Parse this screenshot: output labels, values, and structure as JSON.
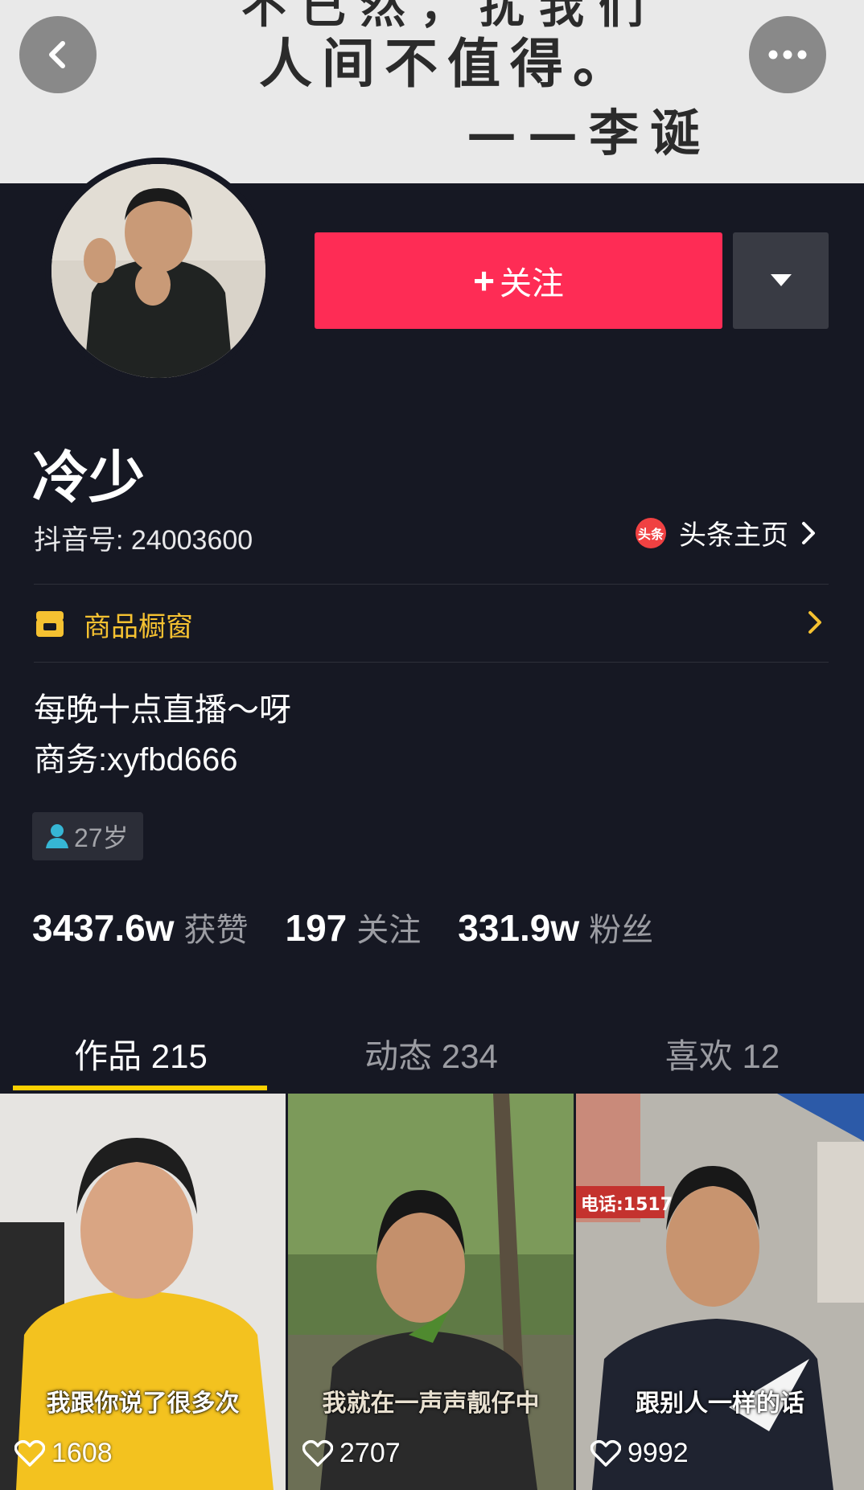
{
  "cover": {
    "line1": "不已然，扰我们",
    "line2": "人间不值得。",
    "line3": "——李诞"
  },
  "profile": {
    "nickname": "冷少",
    "douyin_id": "抖音号: 24003600",
    "toutiao_logo_text": "头条",
    "toutiao_label": "头条主页",
    "follow_label": "关注",
    "follow_plus": "+",
    "shop_label": "商品橱窗",
    "bio_line1": "每晚十点直播～呀",
    "bio_line2": "商务:xyfbd666",
    "age": "27岁"
  },
  "stats": [
    {
      "value": "3437.6w",
      "label": "获赞"
    },
    {
      "value": "197",
      "label": "关注"
    },
    {
      "value": "331.9w",
      "label": "粉丝"
    }
  ],
  "tabs": [
    {
      "label": "作品 215"
    },
    {
      "label": "动态 234"
    },
    {
      "label": "喜欢 12"
    }
  ],
  "videos": [
    {
      "caption": "我跟你说了很多次",
      "likes": "1608"
    },
    {
      "caption": "我就在一声声靓仔中",
      "likes": "2707"
    },
    {
      "caption": "跟别人一样的话",
      "likes": "9992",
      "sign_text": "电话:1517"
    }
  ],
  "colors": {
    "background": "#161823",
    "follow": "#fe2c55",
    "shop": "#f5c131",
    "tab_indicator": "#fbd000"
  },
  "icons": [
    "back-arrow-icon",
    "more-dots-icon",
    "dropdown-triangle-icon",
    "chevron-right-icon",
    "shop-icon",
    "person-icon",
    "heart-icon"
  ]
}
